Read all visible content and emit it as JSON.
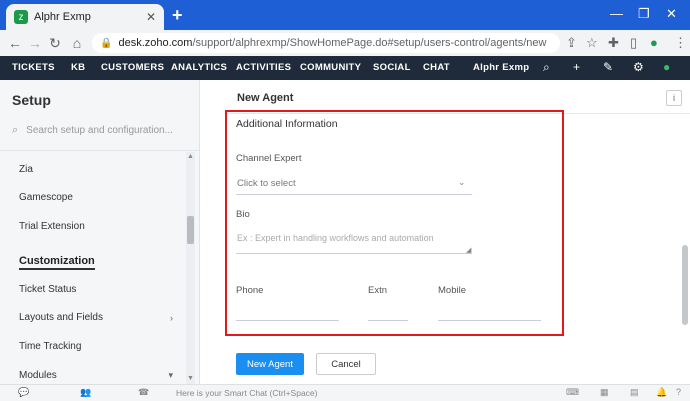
{
  "browser": {
    "tab_title": "Alphr Exmp",
    "url_host": "desk.zoho.com",
    "url_path": "/support/alphrexmp/ShowHomePage.do#setup/users-control/agents/new"
  },
  "nav": {
    "items": [
      "TICKETS",
      "KB",
      "CUSTOMERS",
      "ANALYTICS",
      "ACTIVITIES",
      "COMMUNITY",
      "SOCIAL",
      "CHAT"
    ],
    "portal": "Alphr Exmp"
  },
  "sidebar": {
    "title": "Setup",
    "search_placeholder": "Search setup and configuration...",
    "items": [
      "Zia",
      "Gamescope",
      "Trial Extension"
    ],
    "section": "Customization",
    "section_items": [
      "Ticket Status",
      "Layouts and Fields",
      "Time Tracking",
      "Modules"
    ]
  },
  "main": {
    "title": "New Agent",
    "help": "i",
    "section_title": "Additional Information",
    "channel_label": "Channel Expert",
    "channel_value": "Click to select",
    "bio_label": "Bio",
    "bio_placeholder": "Ex : Expert in handling workflows and automation",
    "phone_label": "Phone",
    "extn_label": "Extn",
    "mobile_label": "Mobile",
    "submit_label": "New Agent",
    "cancel_label": "Cancel"
  },
  "bottom": {
    "smart_chat": "Here is your Smart Chat (Ctrl+Space)",
    "icons": [
      "Chats",
      "Channels",
      "Contacts"
    ]
  },
  "colors": {
    "browser_blue": "#1e5fd6",
    "nav_bg": "#1f2a3a",
    "primary_button": "#1b8ef2",
    "highlight_border": "#e0191f"
  }
}
